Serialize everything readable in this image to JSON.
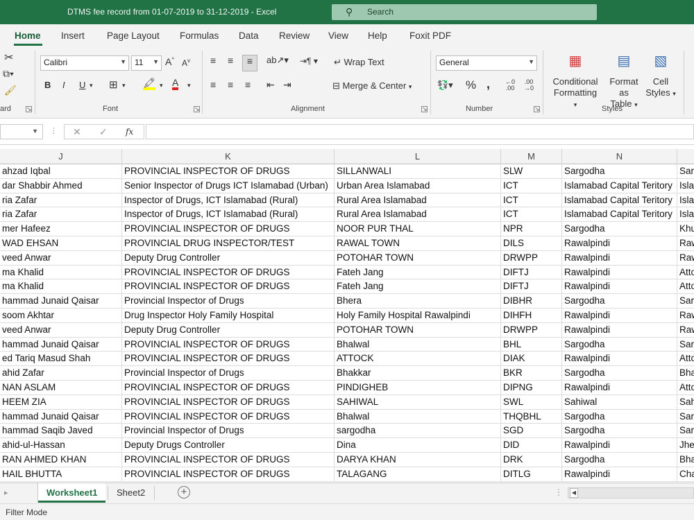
{
  "window": {
    "title": "DTMS fee record from 01-07-2019 to 31-12-2019  -  Excel",
    "search_label": "Search"
  },
  "menu": {
    "tabs": [
      "Home",
      "Insert",
      "Page Layout",
      "Formulas",
      "Data",
      "Review",
      "View",
      "Help",
      "Foxit PDF"
    ],
    "active": "Home"
  },
  "ribbon": {
    "groups": {
      "clipboard": "ard",
      "font": "Font",
      "alignment": "Alignment",
      "number": "Number",
      "styles": "Styles"
    },
    "font_name": "Calibri",
    "font_size": "11",
    "wrap_text": "Wrap Text",
    "merge_center": "Merge & Center",
    "number_format": "General",
    "conditional_formatting": [
      "Conditional",
      "Formatting"
    ],
    "format_as_table": [
      "Format as",
      "Table"
    ],
    "cell_styles": [
      "Cell",
      "Styles"
    ],
    "bold": "B",
    "italic": "I",
    "underline": "U",
    "percent": "%",
    "comma": ","
  },
  "formula_bar": {
    "fx_label": "fx",
    "value": ""
  },
  "columns": [
    "J",
    "K",
    "L",
    "M",
    "N"
  ],
  "rows": [
    [
      "ahzad Iqbal",
      "PROVINCIAL INSPECTOR OF DRUGS",
      "SILLANWALI",
      "SLW",
      "Sargodha",
      "Sar"
    ],
    [
      "dar Shabbir Ahmed",
      "Senior Inspector of Drugs ICT Islamabad (Urban)",
      "Urban Area Islamabad",
      "ICT",
      "Islamabad Capital Teritory",
      "Isla"
    ],
    [
      "ria Zafar",
      "Inspector of Drugs, ICT Islamabad (Rural)",
      "Rural Area Islamabad",
      "ICT",
      "Islamabad Capital Teritory",
      "Isla"
    ],
    [
      "ria Zafar",
      "Inspector of Drugs, ICT Islamabad (Rural)",
      "Rural Area Islamabad",
      "ICT",
      "Islamabad Capital Teritory",
      "Isla"
    ],
    [
      "mer Hafeez",
      "PROVINCIAL INSPECTOR OF DRUGS",
      "NOOR PUR THAL",
      "NPR",
      "Sargodha",
      "Khu"
    ],
    [
      "WAD EHSAN",
      "PROVINCIAL DRUG INSPECTOR/TEST",
      "RAWAL TOWN",
      "DILS",
      "Rawalpindi",
      "Raw"
    ],
    [
      "veed Anwar",
      "Deputy Drug Controller",
      "POTOHAR TOWN",
      "DRWPP",
      "Rawalpindi",
      "Raw"
    ],
    [
      "ma Khalid",
      "PROVINCIAL INSPECTOR OF DRUGS",
      "Fateh Jang",
      "DIFTJ",
      "Rawalpindi",
      "Atto"
    ],
    [
      "ma Khalid",
      "PROVINCIAL INSPECTOR OF DRUGS",
      "Fateh Jang",
      "DIFTJ",
      "Rawalpindi",
      "Atto"
    ],
    [
      "hammad Junaid Qaisar",
      "Provincial Inspector of Drugs",
      "Bhera",
      "DIBHR",
      "Sargodha",
      "Sar"
    ],
    [
      "soom Akhtar",
      "Drug Inspector Holy Family Hospital",
      "Holy Family Hospital Rawalpindi",
      "DIHFH",
      "Rawalpindi",
      "Raw"
    ],
    [
      "veed Anwar",
      "Deputy Drug Controller",
      "POTOHAR TOWN",
      "DRWPP",
      "Rawalpindi",
      "Raw"
    ],
    [
      "hammad Junaid Qaisar",
      "PROVINCIAL INSPECTOR OF DRUGS",
      "Bhalwal",
      "BHL",
      "Sargodha",
      "Sar"
    ],
    [
      "ed Tariq Masud Shah",
      "PROVINCIAL INSPECTOR OF DRUGS",
      "ATTOCK",
      "DIAK",
      "Rawalpindi",
      "Atto"
    ],
    [
      "ahid Zafar",
      "Provincial Inspector of Drugs",
      "Bhakkar",
      "BKR",
      "Sargodha",
      "Bha"
    ],
    [
      "NAN ASLAM",
      "PROVINCIAL INSPECTOR OF DRUGS",
      "PINDIGHEB",
      "DIPNG",
      "Rawalpindi",
      "Atto"
    ],
    [
      "HEEM ZIA",
      "PROVINCIAL INSPECTOR OF DRUGS",
      "SAHIWAL",
      "SWL",
      "Sahiwal",
      "Sah"
    ],
    [
      "hammad Junaid Qaisar",
      "PROVINCIAL INSPECTOR OF DRUGS",
      "Bhalwal",
      "THQBHL",
      "Sargodha",
      "Sar"
    ],
    [
      "hammad Saqib Javed",
      "Provincial Inspector of Drugs",
      "sargodha",
      "SGD",
      "Sargodha",
      "Sar"
    ],
    [
      "ahid-ul-Hassan",
      "Deputy Drugs Controller",
      "Dina",
      "DID",
      "Rawalpindi",
      "Jhe"
    ],
    [
      "RAN AHMED KHAN",
      "PROVINCIAL INSPECTOR OF DRUGS",
      "DARYA KHAN",
      "DRK",
      "Sargodha",
      "Bha"
    ],
    [
      "HAIL BHUTTA",
      "PROVINCIAL INSPECTOR OF DRUGS",
      "TALAGANG",
      "DITLG",
      "Rawalpindi",
      "Cha"
    ]
  ],
  "sheets": [
    "Worksheet1",
    "Sheet2"
  ],
  "active_sheet": "Worksheet1",
  "status": "Filter Mode"
}
